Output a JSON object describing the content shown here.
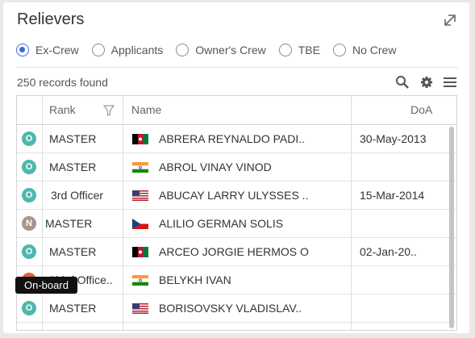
{
  "widget": {
    "title": "Relievers"
  },
  "filters": [
    {
      "label": "Ex-Crew",
      "checked": true
    },
    {
      "label": "Applicants",
      "checked": false
    },
    {
      "label": "Owner's Crew",
      "checked": false
    },
    {
      "label": "TBE",
      "checked": false
    },
    {
      "label": "No Crew",
      "checked": false
    }
  ],
  "records_label": "250 records found",
  "columns": {
    "rank": "Rank",
    "name": "Name",
    "doa": "DoA"
  },
  "rows": [
    {
      "status": "O",
      "status_color": "#4fb8ad",
      "rank": "MASTER",
      "flag": "afghanistan",
      "name": "ABRERA REYNALDO PADI..",
      "doa": "30-May-2013"
    },
    {
      "status": "O",
      "status_color": "#4fb8ad",
      "rank": "MASTER",
      "flag": "india",
      "name": "ABROL VINAY VINOD",
      "doa": ""
    },
    {
      "status": "O",
      "status_color": "#4fb8ad",
      "rank": "3rd Officer",
      "flag": "usa",
      "name": "ABUCAY LARRY ULYSSES ..",
      "doa": "15-Mar-2014"
    },
    {
      "status": "N",
      "status_color": "#a9958a",
      "rank": "MASTER",
      "flag": "czech",
      "name": "ALILIO GERMAN SOLIS",
      "doa": ""
    },
    {
      "status": "O",
      "status_color": "#4fb8ad",
      "rank": "MASTER",
      "flag": "afghanistan",
      "name": "ARCEO JORGIE HERMOS O",
      "doa": "02-Jan-20.."
    },
    {
      "status": "",
      "status_color": "#e0623e",
      "rank": "Chief Office..",
      "flag": "india",
      "name": "BELYKH IVAN",
      "doa": ""
    },
    {
      "status": "O",
      "status_color": "#4fb8ad",
      "rank": "MASTER",
      "flag": "usa",
      "name": "BORISOVSKY VLADISLAV..",
      "doa": ""
    }
  ],
  "tooltip": "On-board",
  "icons": [
    "expand-icon",
    "search-icon",
    "gear-icon",
    "menu-icon",
    "filter-icon"
  ]
}
